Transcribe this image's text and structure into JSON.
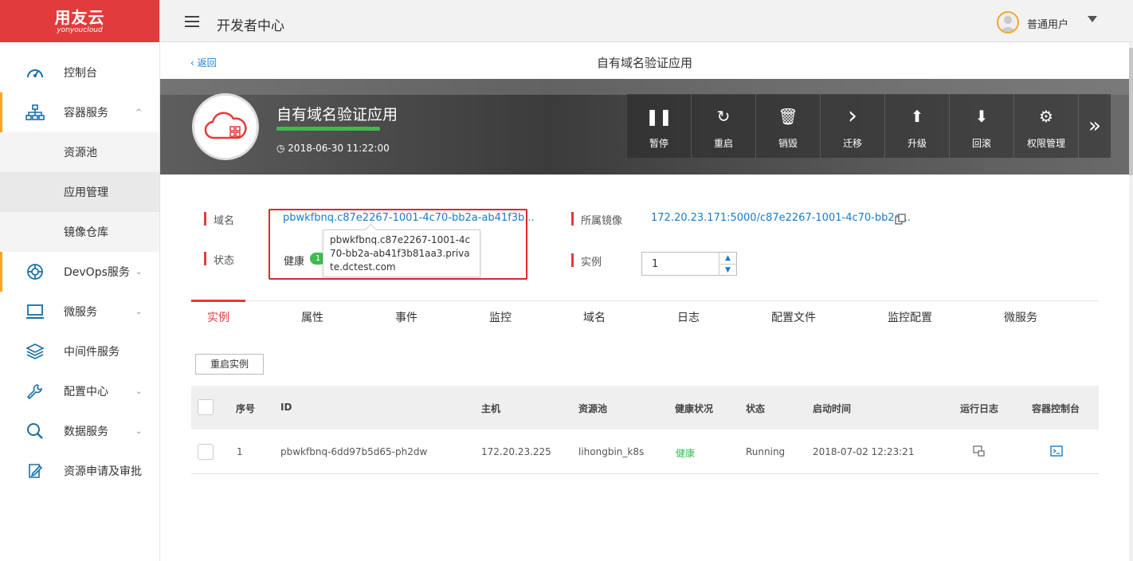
{
  "logo": {
    "brand": "用友云",
    "sub": "yonyoucloud"
  },
  "topbar": {
    "title": "开发者中心",
    "user_name": "普通用户"
  },
  "sidebar": {
    "items": [
      {
        "label": "控制台",
        "icon": "dashboard-icon"
      },
      {
        "label": "容器服务",
        "icon": "hierarchy-icon",
        "chevron": "^"
      },
      {
        "label": "资源池"
      },
      {
        "label": "应用管理"
      },
      {
        "label": "镜像仓库"
      },
      {
        "label": "DevOps服务",
        "icon": "lifebuoy-icon",
        "chevron": "⌄"
      },
      {
        "label": "微服务",
        "icon": "laptop-icon",
        "chevron": "⌄"
      },
      {
        "label": "中间件服务",
        "icon": "layers-icon"
      },
      {
        "label": "配置中心",
        "icon": "wrench-icon",
        "chevron": "⌄"
      },
      {
        "label": "数据服务",
        "icon": "search-icon",
        "chevron": "⌄"
      },
      {
        "label": "资源申请及审批",
        "icon": "edit-doc-icon"
      }
    ]
  },
  "subheader": {
    "back_label": "返回",
    "title": "自有域名验证应用"
  },
  "banner": {
    "app_name": "自有域名验证应用",
    "created_time": "2018-06-30 11:22:00",
    "actions": [
      {
        "label": "暂停",
        "icon": "pause-icon",
        "glyph": "❚❚"
      },
      {
        "label": "重启",
        "icon": "restart-icon",
        "glyph": "↻"
      },
      {
        "label": "销毁",
        "icon": "trash-icon",
        "glyph": "🗑"
      },
      {
        "label": "迁移",
        "icon": "chevron-right-icon",
        "glyph": "›"
      },
      {
        "label": "升级",
        "icon": "upgrade-icon",
        "glyph": "⬆"
      },
      {
        "label": "回滚",
        "icon": "rollback-icon",
        "glyph": "⬇"
      },
      {
        "label": "权限管理",
        "icon": "user-gear-icon",
        "glyph": "⚙"
      }
    ],
    "more_glyph": "»"
  },
  "info": {
    "domain_label": "域名",
    "domain_value": "pbwkfbnq.c87e2267-1001-4c70-bb2a-ab41f3b...",
    "status_label": "状态",
    "status_value": "健康",
    "status_badge": "1",
    "image_label": "所属镜像",
    "image_value": "172.20.23.171:5000/c87e2267-1001-4c70-bb2a...",
    "instance_label": "实例",
    "instance_value": "1",
    "tooltip": "pbwkfbnq.c87e2267-1001-4c70-bb2a-ab41f3b81aa3.private.dctest.com"
  },
  "tabs": [
    "实例",
    "属性",
    "事件",
    "监控",
    "域名",
    "日志",
    "配置文件",
    "监控配置",
    "微服务"
  ],
  "restart_button": "重启实例",
  "table": {
    "headers": [
      "序号",
      "ID",
      "主机",
      "资源池",
      "健康状况",
      "状态",
      "启动时间",
      "运行日志",
      "容器控制台"
    ],
    "rows": [
      {
        "index": "1",
        "id": "pbwkfbnq-6dd97b5d65-ph2dw",
        "host": "172.20.23.225",
        "pool": "lihongbin_k8s",
        "health": "健康",
        "status": "Running",
        "start_time": "2018-07-02 12:23:21"
      }
    ]
  }
}
